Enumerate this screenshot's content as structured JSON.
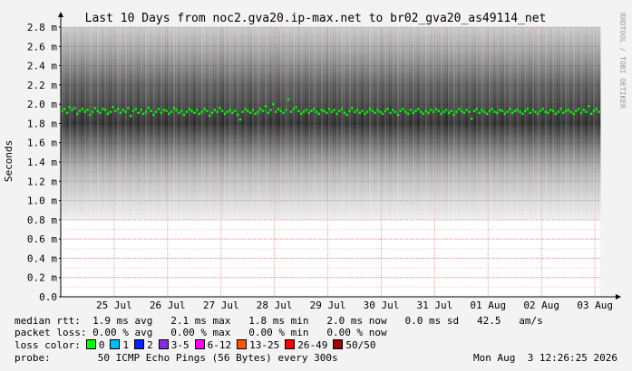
{
  "chart_data": {
    "type": "scatter",
    "title": "Last 10 Days from noc2.gva20.ip-max.net to br02_gva20_as49114_net",
    "ylabel": "Seconds",
    "watermark": "RRDTOOL / TOBI OETIKER",
    "ylim": [
      0,
      2.8
    ],
    "yticks": [
      {
        "value": 0.0,
        "label": "0.0"
      },
      {
        "value": 0.2,
        "label": "0.2 m"
      },
      {
        "value": 0.4,
        "label": "0.4 m"
      },
      {
        "value": 0.6,
        "label": "0.6 m"
      },
      {
        "value": 0.8,
        "label": "0.8 m"
      },
      {
        "value": 1.0,
        "label": "1.0 m"
      },
      {
        "value": 1.2,
        "label": "1.2 m"
      },
      {
        "value": 1.4,
        "label": "1.4 m"
      },
      {
        "value": 1.6,
        "label": "1.6 m"
      },
      {
        "value": 1.8,
        "label": "1.8 m"
      },
      {
        "value": 2.0,
        "label": "2.0 m"
      },
      {
        "value": 2.2,
        "label": "2.2 m"
      },
      {
        "value": 2.4,
        "label": "2.4 m"
      },
      {
        "value": 2.6,
        "label": "2.6 m"
      },
      {
        "value": 2.8,
        "label": "2.8 m"
      }
    ],
    "xticks": [
      "25 Jul",
      "26 Jul",
      "27 Jul",
      "28 Jul",
      "29 Jul",
      "30 Jul",
      "31 Jul",
      "01 Aug",
      "02 Aug",
      "03 Aug"
    ],
    "x_range_days": [
      0,
      10.1
    ],
    "xtick_positions_days": [
      1,
      2,
      3,
      4,
      5,
      6,
      7,
      8,
      9,
      10
    ],
    "smoke_range": {
      "min": 0.8,
      "max": 2.8
    },
    "median_series": [
      1.93,
      1.95,
      1.91,
      1.97,
      1.94,
      1.96,
      1.9,
      1.93,
      1.95,
      1.92,
      1.94,
      1.89,
      1.92,
      1.96,
      1.93,
      1.91,
      1.95,
      1.94,
      1.9,
      1.92,
      1.97,
      1.93,
      1.95,
      1.91,
      1.94,
      1.92,
      1.96,
      1.88,
      1.93,
      1.95,
      1.91,
      1.94,
      1.9,
      1.92,
      1.96,
      1.93,
      1.89,
      1.92,
      1.95,
      1.91,
      1.94,
      1.93,
      1.9,
      1.92,
      1.96,
      1.94,
      1.91,
      1.93,
      1.89,
      1.92,
      1.95,
      1.93,
      1.91,
      1.94,
      1.9,
      1.92,
      1.95,
      1.93,
      1.88,
      1.91,
      1.94,
      1.92,
      1.96,
      1.93,
      1.9,
      1.92,
      1.94,
      1.91,
      1.93,
      1.89,
      1.84,
      1.92,
      1.95,
      1.93,
      1.91,
      1.94,
      1.9,
      1.92,
      1.95,
      1.93,
      1.98,
      1.91,
      1.94,
      2.0,
      1.92,
      1.95,
      1.93,
      1.91,
      1.94,
      2.05,
      1.92,
      1.95,
      1.97,
      1.93,
      1.9,
      1.92,
      1.94,
      1.91,
      1.93,
      1.95,
      1.92,
      1.9,
      1.94,
      1.93,
      1.91,
      1.95,
      1.92,
      1.94,
      1.9,
      1.93,
      1.95,
      1.91,
      1.89,
      1.93,
      1.96,
      1.92,
      1.94,
      1.91,
      1.93,
      1.9,
      1.92,
      1.95,
      1.93,
      1.91,
      1.94,
      1.92,
      1.9,
      1.93,
      1.95,
      1.91,
      1.94,
      1.92,
      1.89,
      1.93,
      1.95,
      1.92,
      1.9,
      1.94,
      1.91,
      1.93,
      1.95,
      1.92,
      1.9,
      1.93,
      1.91,
      1.94,
      1.92,
      1.95,
      1.93,
      1.9,
      1.92,
      1.94,
      1.91,
      1.93,
      1.89,
      1.92,
      1.95,
      1.93,
      1.91,
      1.94,
      1.92,
      1.85,
      1.93,
      1.95,
      1.91,
      1.94,
      1.92,
      1.9,
      1.93,
      1.95,
      1.92,
      1.91,
      1.94,
      1.93,
      1.9,
      1.92,
      1.95,
      1.91,
      1.93,
      1.94,
      1.92,
      1.9,
      1.93,
      1.95,
      1.91,
      1.94,
      1.92,
      1.9,
      1.93,
      1.95,
      1.92,
      1.91,
      1.94,
      1.93,
      1.9,
      1.92,
      1.95,
      1.91,
      1.93,
      1.94,
      1.92,
      1.9,
      1.93,
      1.95,
      1.91,
      1.94,
      1.92,
      1.98,
      1.9,
      1.93,
      1.95,
      1.92
    ],
    "series": [
      {
        "name": "median rtt",
        "color": "#00ff00"
      }
    ]
  },
  "legend": {
    "median_label": "median rtt:",
    "median_values": "  1.9 ms avg   2.1 ms max   1.8 ms min   2.0 ms now   0.0 ms sd   42.5   am/s",
    "loss_label": "packet loss:",
    "loss_values": " 0.00 % avg   0.00 % max   0.00 % min   0.00 % now",
    "color_label": "loss color:",
    "loss_colors": [
      {
        "label": "0",
        "color": "#00ff00"
      },
      {
        "label": "1",
        "color": "#00bbff"
      },
      {
        "label": "2",
        "color": "#0022ff"
      },
      {
        "label": "3-5",
        "color": "#8a2be2"
      },
      {
        "label": "6-12",
        "color": "#ff00ff"
      },
      {
        "label": "13-25",
        "color": "#ff5500"
      },
      {
        "label": "26-49",
        "color": "#ff0000"
      },
      {
        "label": "50/50",
        "color": "#a00000"
      }
    ],
    "probe_label": "probe:",
    "probe_text": "50 ICMP Echo Pings (56 Bytes) every 300s",
    "timestamp": "Mon Aug  3 12:26:25 2026"
  }
}
